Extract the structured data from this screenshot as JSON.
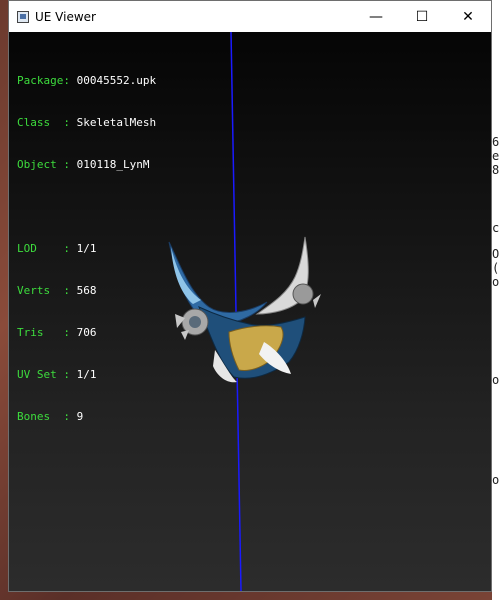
{
  "window": {
    "title": "UE Viewer",
    "controls": {
      "minimize": "—",
      "maximize": "☐",
      "close": "✕"
    }
  },
  "info": {
    "package": {
      "key": "Package:",
      "value": "00045552.upk"
    },
    "class": {
      "key": "Class  :",
      "value": "SkeletalMesh"
    },
    "object": {
      "key": "Object :",
      "value": "010118_LynM"
    },
    "lod": {
      "key": "LOD    :",
      "value": "1/1"
    },
    "verts": {
      "key": "Verts  :",
      "value": "568"
    },
    "tris": {
      "key": "Tris   :",
      "value": "706"
    },
    "uvset": {
      "key": "UV Set :",
      "value": "1/1"
    },
    "bones": {
      "key": "Bones  :",
      "value": "9"
    }
  },
  "background_fragments": [
    "6",
    "e",
    "8",
    "c",
    "O",
    "(",
    "o",
    "o",
    "o"
  ],
  "colors": {
    "label_green": "#3ddc3d",
    "value_white": "#ffffff",
    "axis_blue": "#1a1aff"
  }
}
